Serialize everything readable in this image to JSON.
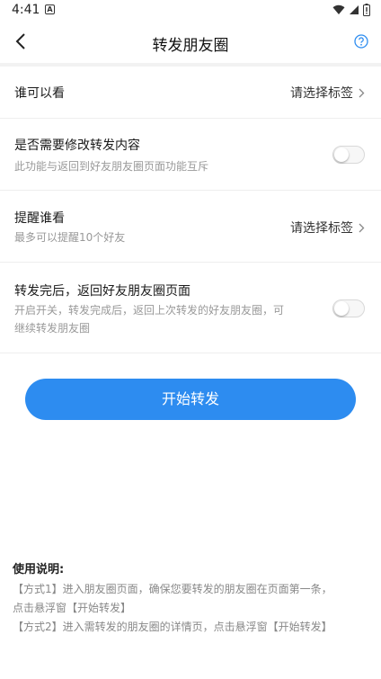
{
  "status_bar": {
    "time": "4:41",
    "a_badge": "A"
  },
  "nav": {
    "title": "转发朋友圈"
  },
  "settings": [
    {
      "title": "谁可以看",
      "value": "请选择标签"
    },
    {
      "title": "是否需要修改转发内容",
      "subtitle": "此功能与返回到好友朋友圈页面功能互斥",
      "toggle_on": false
    },
    {
      "title": "提醒谁看",
      "subtitle": "最多可以提醒10个好友",
      "value": "请选择标签"
    },
    {
      "title": "转发完后，返回好友朋友圈页面",
      "subtitle_line1": "开启开关，转发完成后，返回上次转发的好友朋友圈，可",
      "subtitle_line2": "继续转发朋友圈",
      "toggle_on": false
    }
  ],
  "start_button": {
    "label": "开始转发"
  },
  "usage": {
    "title": "使用说明:",
    "line1": "【方式1】进入朋友圈页面，确保您要转发的朋友圈在页面第一条，",
    "line2": "点击悬浮窗【开始转发】",
    "line3": "【方式2】进入需转发的朋友圈的详情页，点击悬浮窗【开始转发】"
  },
  "colors": {
    "accent": "#2d8cf0",
    "subtext": "#999999"
  }
}
